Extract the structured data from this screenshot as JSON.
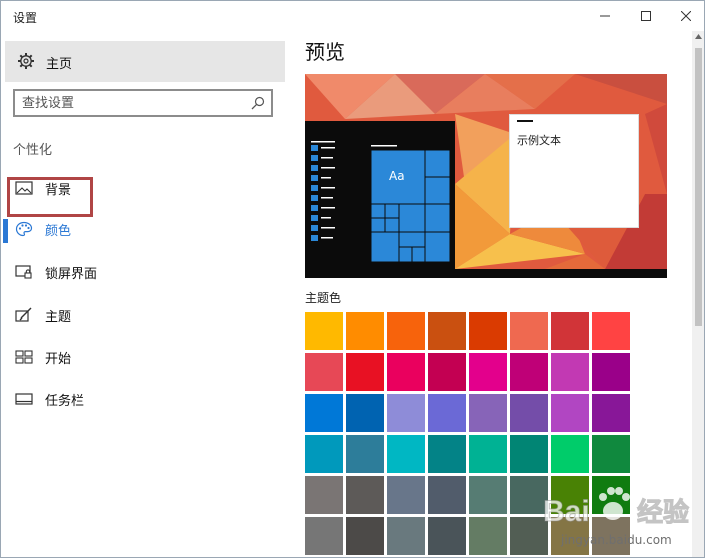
{
  "window": {
    "title": "设置",
    "controls": [
      "minimize-icon",
      "maximize-icon",
      "close-icon"
    ]
  },
  "sidebar": {
    "home_label": "主页",
    "search_placeholder": "查找设置",
    "section_label": "个性化",
    "items": [
      {
        "label": "背景",
        "icon": "image-icon",
        "active": false
      },
      {
        "label": "颜色",
        "icon": "palette-icon",
        "active": true
      },
      {
        "label": "锁屏界面",
        "icon": "lock-screen-icon",
        "active": false
      },
      {
        "label": "主题",
        "icon": "theme-brush-icon",
        "active": false
      },
      {
        "label": "开始",
        "icon": "start-tiles-icon",
        "active": false
      },
      {
        "label": "任务栏",
        "icon": "taskbar-icon",
        "active": false
      }
    ]
  },
  "main": {
    "heading": "预览",
    "preview": {
      "tile_text": "Aa",
      "sample_text": "示例文本"
    },
    "theme_color_label": "主题色",
    "swatches": [
      "#FFB900",
      "#FF8C00",
      "#F7630C",
      "#CA5010",
      "#DA3B01",
      "#EF6950",
      "#D13438",
      "#FF4343",
      "#E74856",
      "#E81123",
      "#EA005E",
      "#C30052",
      "#E3008C",
      "#BF0077",
      "#C239B3",
      "#9A0089",
      "#0078D7",
      "#0063B1",
      "#8E8CD8",
      "#6B69D6",
      "#8764B8",
      "#744DA9",
      "#B146C2",
      "#881798",
      "#0099BC",
      "#2D7D9A",
      "#00B7C3",
      "#038387",
      "#00B294",
      "#018574",
      "#00CC6A",
      "#10893E",
      "#7A7574",
      "#5D5A58",
      "#68768A",
      "#515C6B",
      "#567C73",
      "#486860",
      "#498205",
      "#107C10",
      "#767676",
      "#4C4A48",
      "#69797E",
      "#4A5459",
      "#647C64",
      "#525E54",
      "#847545",
      "#7E735F"
    ]
  },
  "watermark": {
    "brand": "Baidu 经验",
    "url": "jingyan.baidu.com"
  },
  "colors": {
    "accent": "#2B78D4",
    "highlight_box": "#B04545",
    "preview_tile": "#2B88D8"
  }
}
